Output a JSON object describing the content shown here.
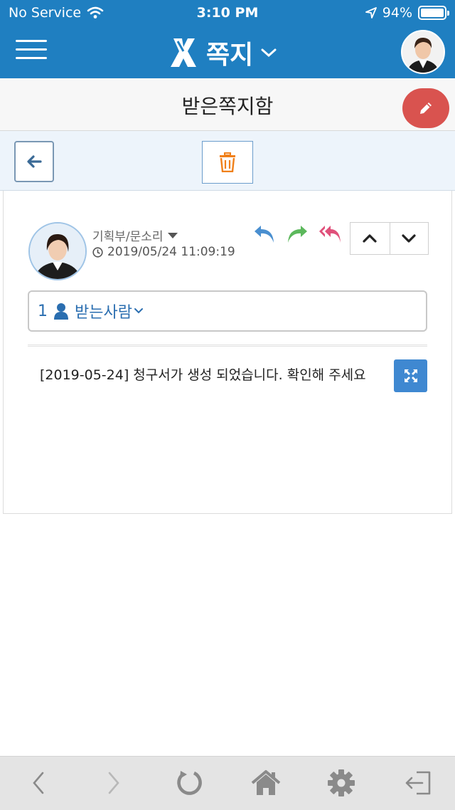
{
  "status_bar": {
    "carrier": "No Service",
    "time": "3:10 PM",
    "battery": "94%",
    "battery_level": 0.94
  },
  "header": {
    "app_title": "쪽지",
    "icons": [
      "menu-icon",
      "app-logo-icon",
      "chevron-down-icon",
      "profile-avatar"
    ]
  },
  "section": {
    "title": "받은쪽지함",
    "compose_icon": "pencil-icon"
  },
  "toolbar": {
    "back_icon": "arrow-left-icon",
    "delete_icon": "trash-icon"
  },
  "message": {
    "sender": "기획부/문소리",
    "date": "2019/05/24 11:09:19",
    "recipient_count": "1",
    "recipients_label": "받는사람",
    "body": "[2019-05-24] 청구서가 생성 되었습니다. 확인해 주세요",
    "actions": [
      "reply-icon",
      "forward-icon",
      "reply-all-icon",
      "chevron-up-icon",
      "chevron-down-icon",
      "expand-icon"
    ]
  },
  "bottom_nav": {
    "items": [
      "back-icon",
      "forward-icon",
      "refresh-icon",
      "home-icon",
      "settings-icon",
      "logout-icon"
    ]
  },
  "colors": {
    "header_bg": "#1f7fc1",
    "compose": "#d9534f",
    "reply": "#4a8fd0",
    "forward": "#5cb85c",
    "reply_all": "#e0507a",
    "trash": "#f0801a"
  }
}
